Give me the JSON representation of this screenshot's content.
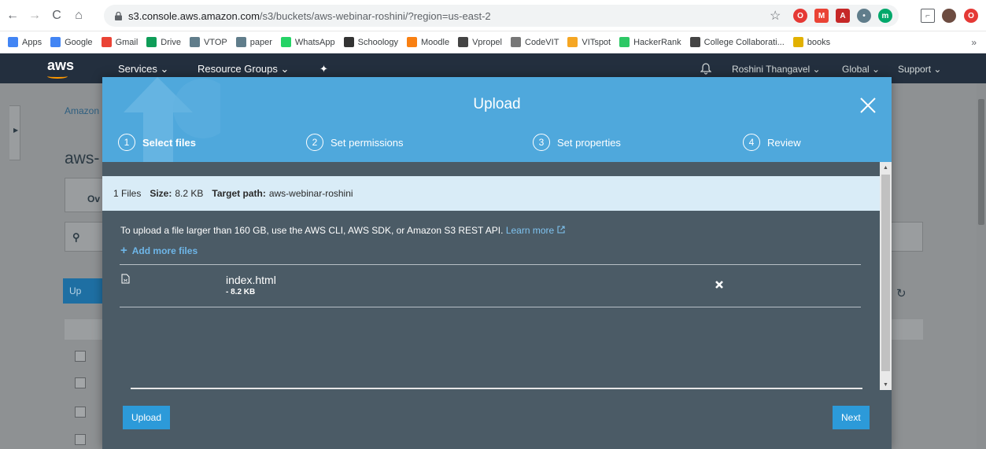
{
  "browser": {
    "url_host": "s3.console.aws.amazon.com",
    "url_path": "/s3/buckets/aws-webinar-roshini/?region=us-east-2",
    "bookmarks": [
      {
        "label": "Apps",
        "color": "#4285f4"
      },
      {
        "label": "Google",
        "color": "#4285f4"
      },
      {
        "label": "Gmail",
        "color": "#ea4335"
      },
      {
        "label": "Drive",
        "color": "#0f9d58"
      },
      {
        "label": "VTOP",
        "color": "#607d8b"
      },
      {
        "label": "paper",
        "color": "#607d8b"
      },
      {
        "label": "WhatsApp",
        "color": "#25d366"
      },
      {
        "label": "Schoology",
        "color": "#333333"
      },
      {
        "label": "Moodle",
        "color": "#f98012"
      },
      {
        "label": "Vpropel",
        "color": "#444444"
      },
      {
        "label": "CodeVIT",
        "color": "#777777"
      },
      {
        "label": "VITspot",
        "color": "#f5a623"
      },
      {
        "label": "HackerRank",
        "color": "#2ec866"
      },
      {
        "label": "College Collaborati...",
        "color": "#444444"
      },
      {
        "label": "books",
        "color": "#e2b100"
      }
    ],
    "more_bookmarks": "»"
  },
  "aws_header": {
    "logo": "aws",
    "services": "Services",
    "resource_groups": "Resource Groups",
    "user": "Roshini Thangavel",
    "region": "Global",
    "support": "Support",
    "chevron": "⌄"
  },
  "background": {
    "breadcrumb": "Amazon",
    "bucket_title": "aws-",
    "tab": "Ov",
    "upload_btn": "Up"
  },
  "modal": {
    "title": "Upload",
    "steps": [
      {
        "num": "1",
        "label": "Select files"
      },
      {
        "num": "2",
        "label": "Set permissions"
      },
      {
        "num": "3",
        "label": "Set properties"
      },
      {
        "num": "4",
        "label": "Review"
      }
    ],
    "info": {
      "files": "1 Files",
      "size_label": "Size:",
      "size_value": "8.2 KB",
      "target_label": "Target path:",
      "target_value": "aws-webinar-roshini"
    },
    "note_text": "To upload a file larger than 160 GB, use the AWS CLI, AWS SDK, or Amazon S3 REST API.",
    "learn_more": "Learn more",
    "add_more": "Add more files",
    "file": {
      "name": "index.html",
      "size": "- 8.2 KB"
    },
    "upload_button": "Upload",
    "next_button": "Next"
  },
  "colors": {
    "modal_header": "#4fa8dc",
    "modal_body": "#4b5b66",
    "button": "#2c9ad9",
    "aws_header": "#232f3e"
  }
}
